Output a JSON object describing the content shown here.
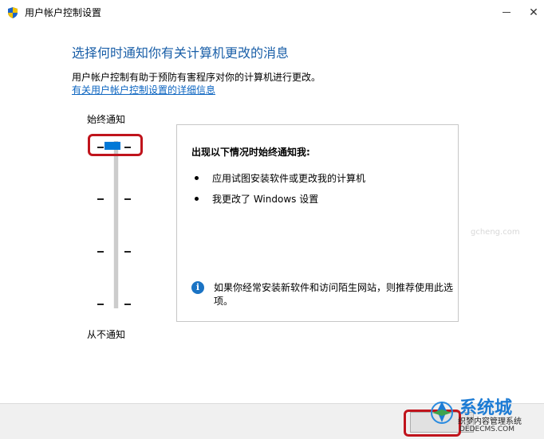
{
  "window": {
    "title": "用户帐户控制设置",
    "minimize_icon": "minimize-icon",
    "close_glyph": "✕"
  },
  "main": {
    "heading": "选择何时通知你有关计算机更改的消息",
    "description": "用户帐户控制有助于预防有害程序对你的计算机进行更改。",
    "link": "有关用户帐户控制设置的详细信息"
  },
  "slider": {
    "label_top": "始终通知",
    "label_bottom": "从不通知",
    "levels": 4,
    "selected_level": 4
  },
  "info_box": {
    "title": "出现以下情况时始终通知我:",
    "bullets": [
      "应用试图安装软件或更改我的计算机",
      "我更改了 Windows 设置"
    ],
    "note": "如果你经常安装新软件和访问陌生网站，则推荐使用此选项。"
  },
  "watermark": {
    "main": "系统城",
    "sub1": "织梦内容管理系统",
    "sub2": "DEDECMS.COM",
    "faint": "gcheng.com"
  },
  "colors": {
    "accent": "#0078d7",
    "heading": "#1a5fa8",
    "link": "#0b64c0",
    "highlight": "#c0141c"
  }
}
